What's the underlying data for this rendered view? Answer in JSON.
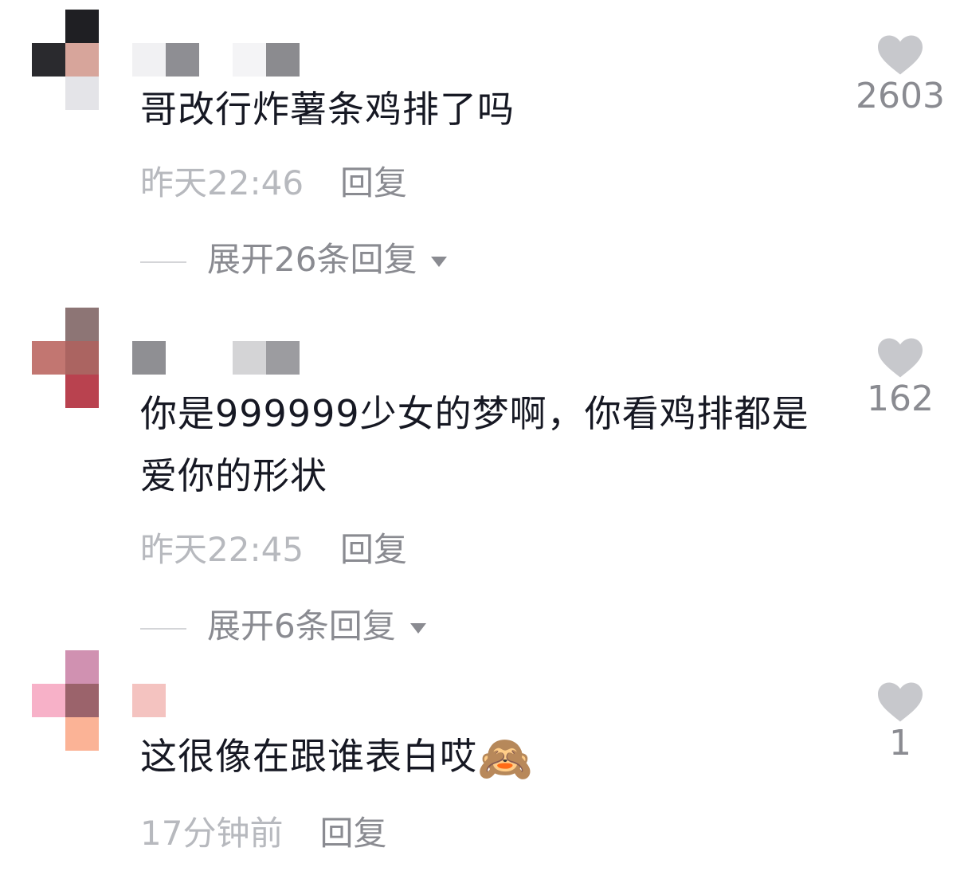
{
  "comments": [
    {
      "text": "哥改行炸薯条鸡排了吗",
      "time": "昨天22:46",
      "reply_label": "回复",
      "expand_label": "展开26条回复",
      "likes": "2603",
      "avatar_pixels": [
        "#1f1f23",
        "#2a2a2e",
        "#d7a59b",
        "#e4e4e8"
      ],
      "name_pixels": [
        "#f1f1f3",
        "#8e8e93",
        "#f4f4f6",
        "#8b8b8f"
      ]
    },
    {
      "text": "你是999999少女的梦啊，你看鸡排都是爱你的形状",
      "time": "昨天22:45",
      "reply_label": "回复",
      "expand_label": "展开6条回复",
      "likes": "162",
      "avatar_pixels": [
        "#8d7575",
        "#c27671",
        "#ab6461",
        "#b9424f"
      ],
      "name_pixels": [
        "#8f8f93",
        "#d4d4d6",
        "#9c9ca0"
      ]
    },
    {
      "text": "这很像在跟谁表白哎",
      "emoji": "🙈",
      "time": "17分钟前",
      "reply_label": "回复",
      "likes": "1",
      "avatar_pixels": [
        "#d091b1",
        "#f7b1c8",
        "#9b636b",
        "#fbb396"
      ],
      "name_pixels": [
        "#f4c3c0"
      ]
    }
  ]
}
